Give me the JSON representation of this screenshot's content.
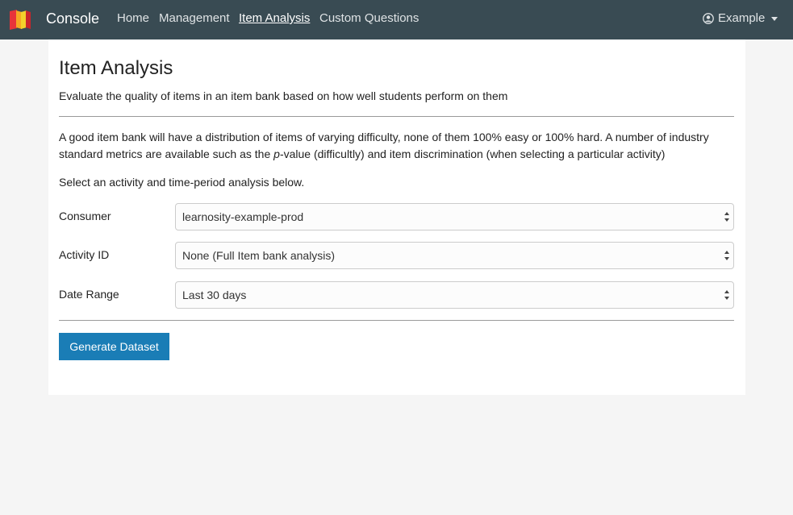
{
  "nav": {
    "brand": "Console",
    "links": [
      {
        "label": "Home",
        "active": false
      },
      {
        "label": "Management",
        "active": false
      },
      {
        "label": "Item Analysis",
        "active": true
      },
      {
        "label": "Custom Questions",
        "active": false
      }
    ],
    "user_label": "Example"
  },
  "page": {
    "title": "Item Analysis",
    "subtitle": "Evaluate the quality of items in an item bank based on how well students perform on them",
    "desc_part1": "A good item bank will have a distribution of items of varying difficulty, none of them 100% easy or 100% hard. A number of industry standard metrics are available such as the ",
    "desc_em": "p",
    "desc_part2": "-value (difficultly) and item discrimination (when selecting a particular activity)",
    "instruction": "Select an activity and time-period analysis below."
  },
  "form": {
    "fields": [
      {
        "label": "Consumer",
        "value": "learnosity-example-prod"
      },
      {
        "label": "Activity ID",
        "value": "None (Full Item bank analysis)"
      },
      {
        "label": "Date Range",
        "value": "Last 30 days"
      }
    ],
    "submit_label": "Generate Dataset"
  },
  "colors": {
    "navbar": "#394b53",
    "button": "#1a7db6",
    "background": "#f5f5f5"
  }
}
